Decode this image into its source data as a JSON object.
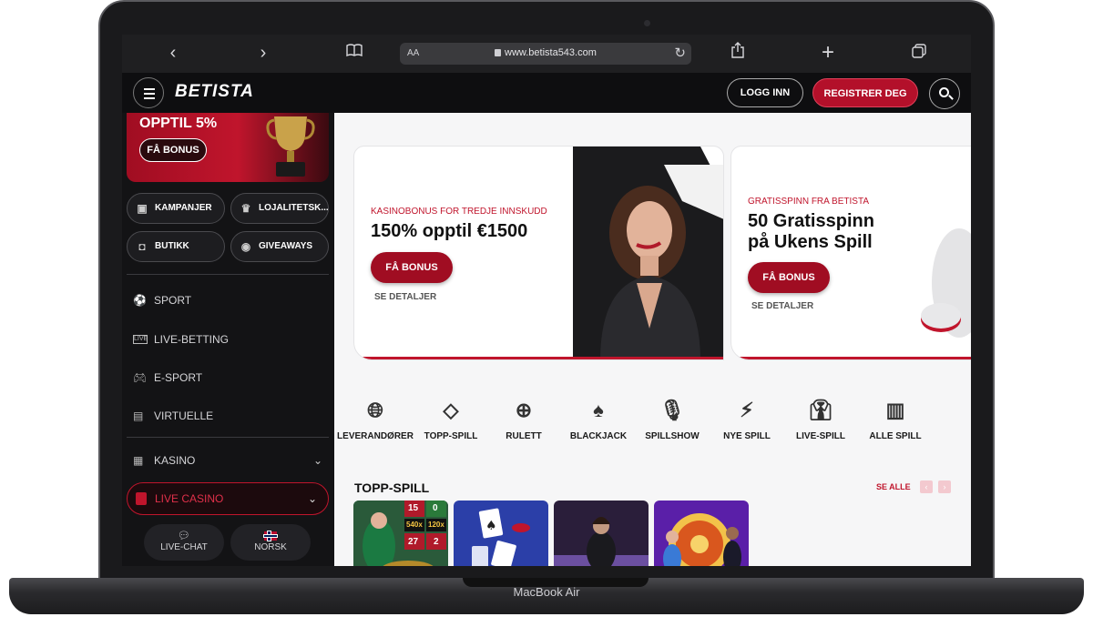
{
  "device": {
    "label": "MacBook Air"
  },
  "browser": {
    "url": "www.betista543.com",
    "text_size_label": "AA"
  },
  "header": {
    "logo": "BETISTA",
    "login_label": "LOGG INN",
    "register_label": "REGISTRER DEG"
  },
  "sidebar": {
    "promo": {
      "title": "OPPTIL 5%",
      "button": "FÅ BONUS"
    },
    "pills": [
      {
        "label": "KAMPANJER",
        "icon": "gift-icon"
      },
      {
        "label": "LOJALITETSK...",
        "icon": "crown-icon"
      },
      {
        "label": "BUTIKK",
        "icon": "bag-icon"
      },
      {
        "label": "GIVEAWAYS",
        "icon": "coin-icon"
      }
    ],
    "nav": [
      {
        "label": "SPORT",
        "icon": "soccer-ball-icon"
      },
      {
        "label": "LIVE-BETTING",
        "icon": "live-icon"
      },
      {
        "label": "E-SPORT",
        "icon": "gamepad-icon"
      },
      {
        "label": "VIRTUELLE",
        "icon": "virtual-icon"
      },
      {
        "label": "KASINO",
        "icon": "slot-machine-icon"
      }
    ],
    "live_casino_label": "LIVE CASINO",
    "footer": {
      "chat_label": "LIVE-CHAT",
      "language_label": "NORSK"
    }
  },
  "banners": [
    {
      "subtitle": "KASINOBONUS FOR TREDJE INNSKUDD",
      "title": "150% opptil €1500",
      "button": "FÅ BONUS",
      "link": "SE DETALJER"
    },
    {
      "subtitle": "GRATISSPINN FRA BETISTA",
      "title_line1": "50 Gratisspinn",
      "title_line2": "på Ukens Spill",
      "button": "FÅ BONUS",
      "link": "SE DETALJER"
    }
  ],
  "categories": [
    {
      "label": "LEVERANDØRER",
      "icon": "globe-icon"
    },
    {
      "label": "TOPP-SPILL",
      "icon": "diamond-icon"
    },
    {
      "label": "RULETT",
      "icon": "roulette-icon"
    },
    {
      "label": "BLACKJACK",
      "icon": "cards-icon"
    },
    {
      "label": "SPILLSHOW",
      "icon": "microphone-icon"
    },
    {
      "label": "NYE SPILL",
      "icon": "lightning-icon"
    },
    {
      "label": "LIVE-SPILL",
      "icon": "dealer-icon"
    },
    {
      "label": "ALLE SPILL",
      "icon": "slot-icon"
    }
  ],
  "top_games": {
    "title": "TOPP-SPILL",
    "see_all": "SE ALLE",
    "thumbnail_texts": {
      "roulette_numbers": [
        "15",
        "0",
        "540x",
        "120x",
        "27",
        "2"
      ]
    }
  },
  "colors": {
    "brand_red": "#c0152c",
    "dark_bg": "#131315"
  }
}
